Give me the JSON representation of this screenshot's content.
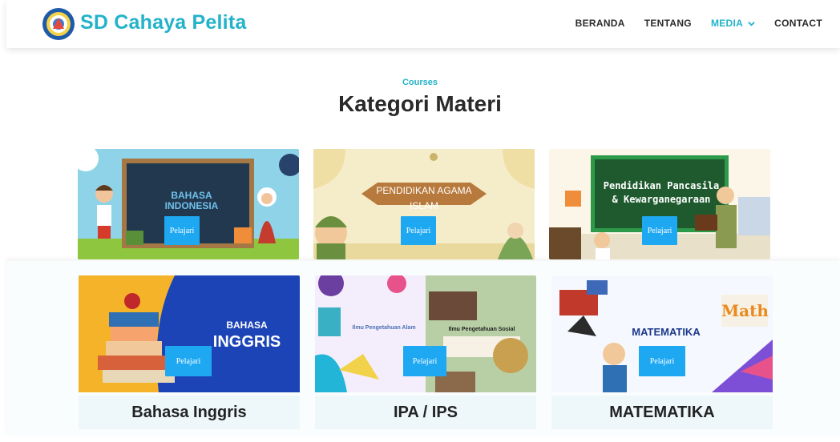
{
  "header": {
    "brand": "SD Cahaya Pelita",
    "nav": [
      {
        "label": "BERANDA"
      },
      {
        "label": "TENTANG"
      },
      {
        "label": "MEDIA"
      },
      {
        "label": "CONTACT"
      }
    ]
  },
  "section": {
    "subtitle": "Courses",
    "title": "Kategori Materi"
  },
  "cards": [
    {
      "banner_line1": "BAHASA",
      "banner_line2": "INDONESIA",
      "button": "Pelajari"
    },
    {
      "banner_line1": "PENDIDIKAN AGAMA",
      "banner_line2": "ISLAM",
      "button": "Pelajari"
    },
    {
      "banner_line1": "Pendidikan Pancasila",
      "banner_line2": "& Kewarganegaraan",
      "button": "Pelajari"
    },
    {
      "banner_line1": "BAHASA",
      "banner_line2": "INGGRIS",
      "button": "Pelajari",
      "caption": "Bahasa Inggris"
    },
    {
      "banner_line1": "Ilmu Pengetahuan Alam",
      "banner_line2": "Ilmu Pengetahuan Sosial",
      "button": "Pelajari",
      "caption": "IPA / IPS"
    },
    {
      "banner_line1": "MATEMATIKA",
      "banner_line2": "Math",
      "button": "Pelajari",
      "caption": "MATEMATIKA"
    }
  ],
  "colors": {
    "accent": "#23b3c9",
    "button": "#1ea8f2"
  }
}
